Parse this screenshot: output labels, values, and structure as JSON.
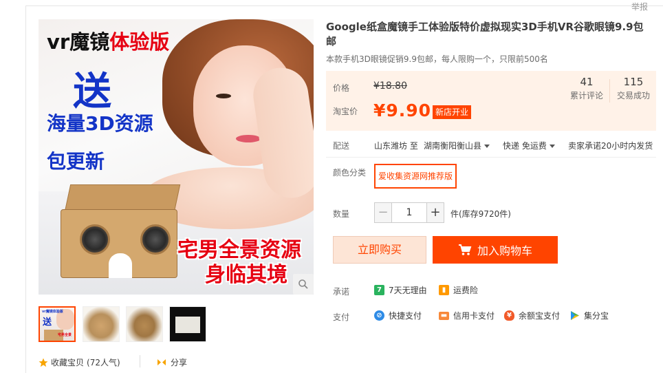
{
  "header": {
    "report_label": "举报"
  },
  "gallery": {
    "promo_line1_a": "vr魔镜",
    "promo_line1_b": "体验版",
    "promo_song": "送",
    "promo_hailiang": "海量3D资源",
    "promo_update": "包更新",
    "promo_zhai": "宅男全景资源",
    "promo_shen": "身临其境",
    "thumb1_mini_top": "vr魔镜体验版",
    "thumb1_mini_big": "送",
    "thumb1_mini_red": "宅男全景"
  },
  "favorite": {
    "label": "收藏宝贝",
    "count_text": "(72人气)"
  },
  "share": {
    "label": "分享"
  },
  "product": {
    "title": "Google纸盒魔镜手工体验版特价虚拟现实3D手机VR谷歌眼镜9.9包邮",
    "subtitle": "本款手机3D眼镜促销9.9包邮，每人限购一个，只限前500名"
  },
  "price": {
    "price_label": "价格",
    "original": "¥18.80",
    "taobao_label": "淘宝价",
    "current": "¥9.90",
    "badge": "新店开业",
    "reviews_count": "41",
    "reviews_label": "累计评论",
    "sales_count": "115",
    "sales_label": "交易成功"
  },
  "shipping": {
    "label": "配送",
    "from": "山东潍坊 至",
    "to": "湖南衡阳衡山县",
    "method": "快递 免运费",
    "promise": "卖家承诺20小时内发货"
  },
  "color": {
    "label": "颜色分类",
    "option": "爱收集资源网推荐版"
  },
  "quantity": {
    "label": "数量",
    "value": "1",
    "minus": "−",
    "plus": "+",
    "stock": "件(库存9720件)"
  },
  "actions": {
    "buy_now": "立即购买",
    "add_cart": "加入购物车"
  },
  "promise": {
    "label": "承诺",
    "items": [
      {
        "text": "7天无理由",
        "icon": "seven-day-icon",
        "color": "#2ab35e",
        "glyph": "7"
      },
      {
        "text": "运费险",
        "icon": "shipping-insurance-icon",
        "color": "#ff9900",
        "glyph": "运"
      }
    ]
  },
  "payment": {
    "label": "支付",
    "items": [
      {
        "text": "快捷支付",
        "icon": "quick-pay-icon",
        "color": "#2e8be6"
      },
      {
        "text": "信用卡支付",
        "icon": "credit-card-icon",
        "color": "#f7893b"
      },
      {
        "text": "余额宝支付",
        "icon": "yuebao-icon",
        "color": "#f15a29"
      },
      {
        "text": "集分宝",
        "icon": "jifenbao-icon",
        "color": "#4caf50"
      }
    ]
  },
  "colors": {
    "accent": "#ff4400",
    "price_bg": "#fff2e8"
  }
}
